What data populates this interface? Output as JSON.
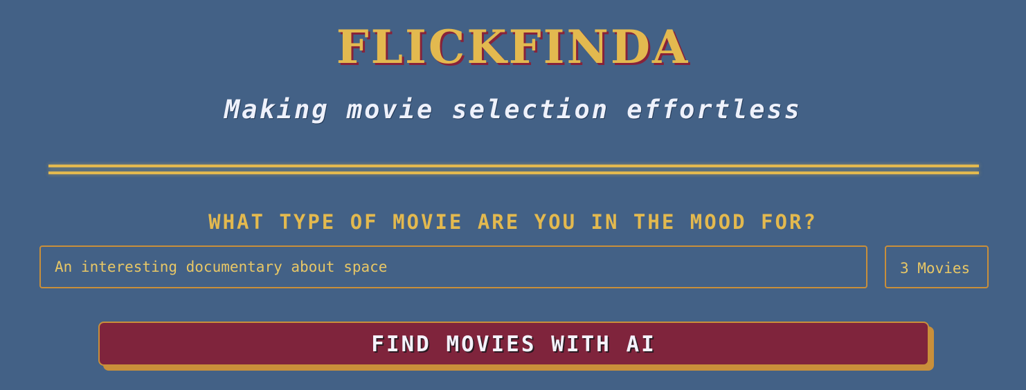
{
  "header": {
    "brand": "FLICKFINDA",
    "tagline": "Making movie selection effortless"
  },
  "search": {
    "prompt": "WHAT TYPE OF MOVIE ARE YOU IN THE MOOD FOR?",
    "query_value": "An interesting documentary about space",
    "count_selected": "3 Movies"
  },
  "actions": {
    "find_label": "FIND MOVIES WITH AI"
  },
  "colors": {
    "background": "#436186",
    "accent_gold": "#e3b94f",
    "border_amber": "#c98f3a",
    "button_maroon": "#7f243c",
    "text_light": "#eef1fb"
  }
}
